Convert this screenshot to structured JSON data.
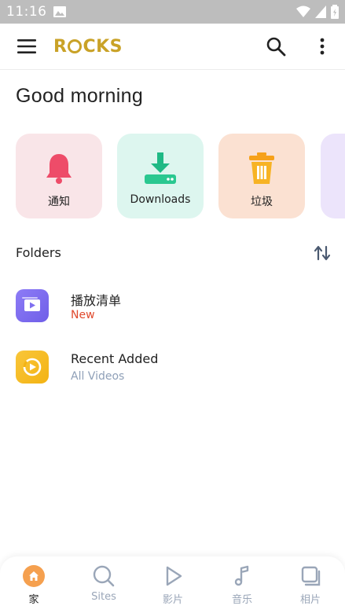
{
  "status_bar": {
    "time": "11:16"
  },
  "app_bar": {
    "logo_text_1": "R",
    "logo_text_2": "CKS",
    "icons": [
      "menu-icon",
      "search-icon",
      "more-vert-icon"
    ]
  },
  "greeting": "Good morning",
  "quick_actions": [
    {
      "label": "通知",
      "icon": "bell-icon",
      "color": "#f0506e"
    },
    {
      "label": "Downloads",
      "icon": "download-icon",
      "color": "#22c08e"
    },
    {
      "label": "垃圾",
      "icon": "trash-icon",
      "color": "#f7a21b"
    }
  ],
  "folders": {
    "title": "Folders",
    "items": [
      {
        "name": "播放清单",
        "subtitle": "New",
        "subtitle_color": "#e0492d",
        "icon": "playlist-icon"
      },
      {
        "name": "Recent Added",
        "subtitle": "All Videos",
        "subtitle_color": "#8fa0b8",
        "icon": "recent-video-icon"
      }
    ]
  },
  "bottom_nav": [
    {
      "label": "家",
      "icon": "home-icon",
      "active": true
    },
    {
      "label": "Sites",
      "icon": "search-icon"
    },
    {
      "label": "影片",
      "icon": "play-icon"
    },
    {
      "label": "音乐",
      "icon": "music-note-icon"
    },
    {
      "label": "相片",
      "icon": "photos-icon"
    }
  ],
  "colors": {
    "accent": "#f5a04f",
    "logo": "#c9a227",
    "nav_inactive": "#9aa6b8"
  }
}
